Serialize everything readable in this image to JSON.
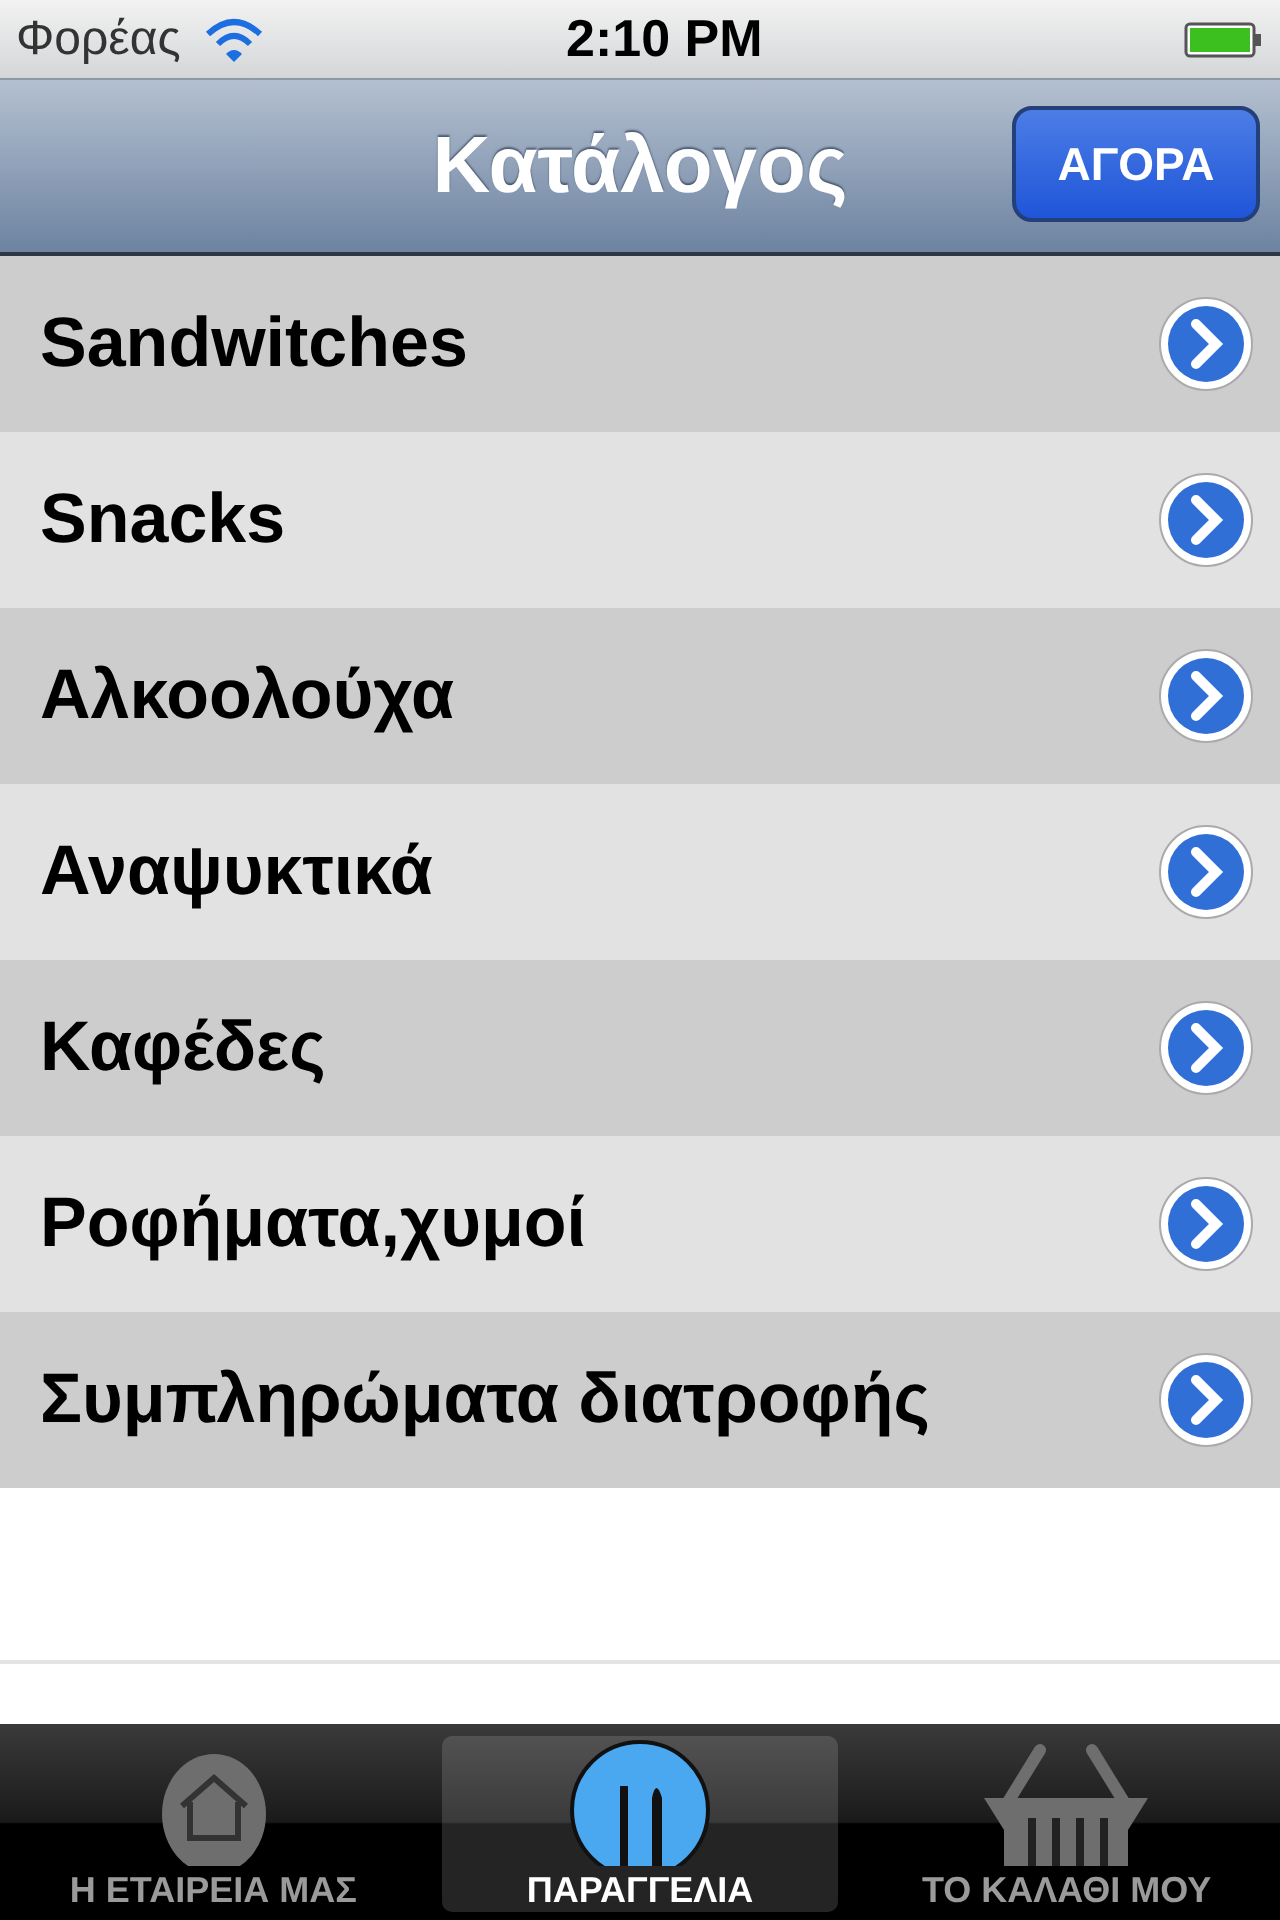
{
  "status_bar": {
    "carrier": "Φορέας",
    "time": "2:10 PM"
  },
  "nav_bar": {
    "title": "Κατάλογος",
    "button": "ΑΓΟΡΑ"
  },
  "list": [
    {
      "label": "Sandwitches"
    },
    {
      "label": "Snacks"
    },
    {
      "label": "Αλκοολούχα"
    },
    {
      "label": "Αναψυκτικά"
    },
    {
      "label": "Καφέδες"
    },
    {
      "label": "Ροφήματα,χυμοί"
    },
    {
      "label": "Συμπληρώματα διατροφής"
    }
  ],
  "tab_bar": [
    {
      "label": "Η ΕΤΑΙΡΕΙΑ ΜΑΣ",
      "kind": "house",
      "selected": false
    },
    {
      "label": "ΠΑΡΑΓΓΕΛΙΑ",
      "kind": "cutlery",
      "selected": true
    },
    {
      "label": "ΤΟ ΚΑΛΑΘΙ ΜΟΥ",
      "kind": "basket",
      "selected": false
    }
  ]
}
